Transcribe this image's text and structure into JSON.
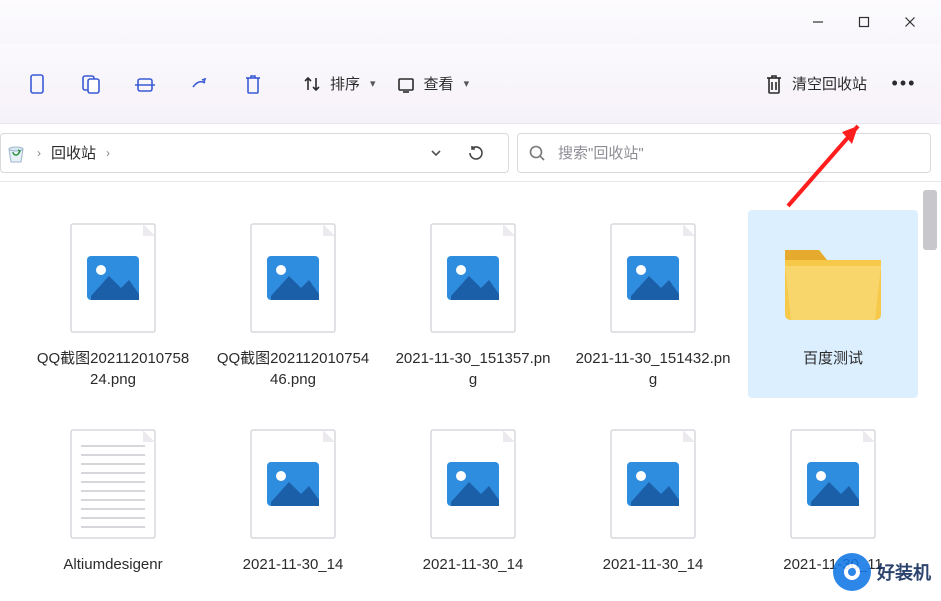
{
  "window": {
    "location": "回收站"
  },
  "toolbar": {
    "sort_label": "排序",
    "view_label": "查看",
    "empty_label": "清空回收站"
  },
  "addressbar": {
    "crumbs": [
      "回收站"
    ]
  },
  "search": {
    "placeholder": "搜索\"回收站\""
  },
  "items": [
    {
      "name": "QQ截图20211201075824.png",
      "type": "image"
    },
    {
      "name": "QQ截图20211201075446.png",
      "type": "image"
    },
    {
      "name": "2021-11-30_151357.png",
      "type": "image"
    },
    {
      "name": "2021-11-30_151432.png",
      "type": "image"
    },
    {
      "name": "百度测试",
      "type": "folder",
      "selected": true
    },
    {
      "name": "Altiumdesigenr",
      "type": "text"
    },
    {
      "name": "2021-11-30_14",
      "type": "image"
    },
    {
      "name": "2021-11-30_14",
      "type": "image"
    },
    {
      "name": "2021-11-30_14",
      "type": "image"
    },
    {
      "name": "2021-11-30_11",
      "type": "image"
    }
  ],
  "watermark": {
    "text": "好装机"
  }
}
